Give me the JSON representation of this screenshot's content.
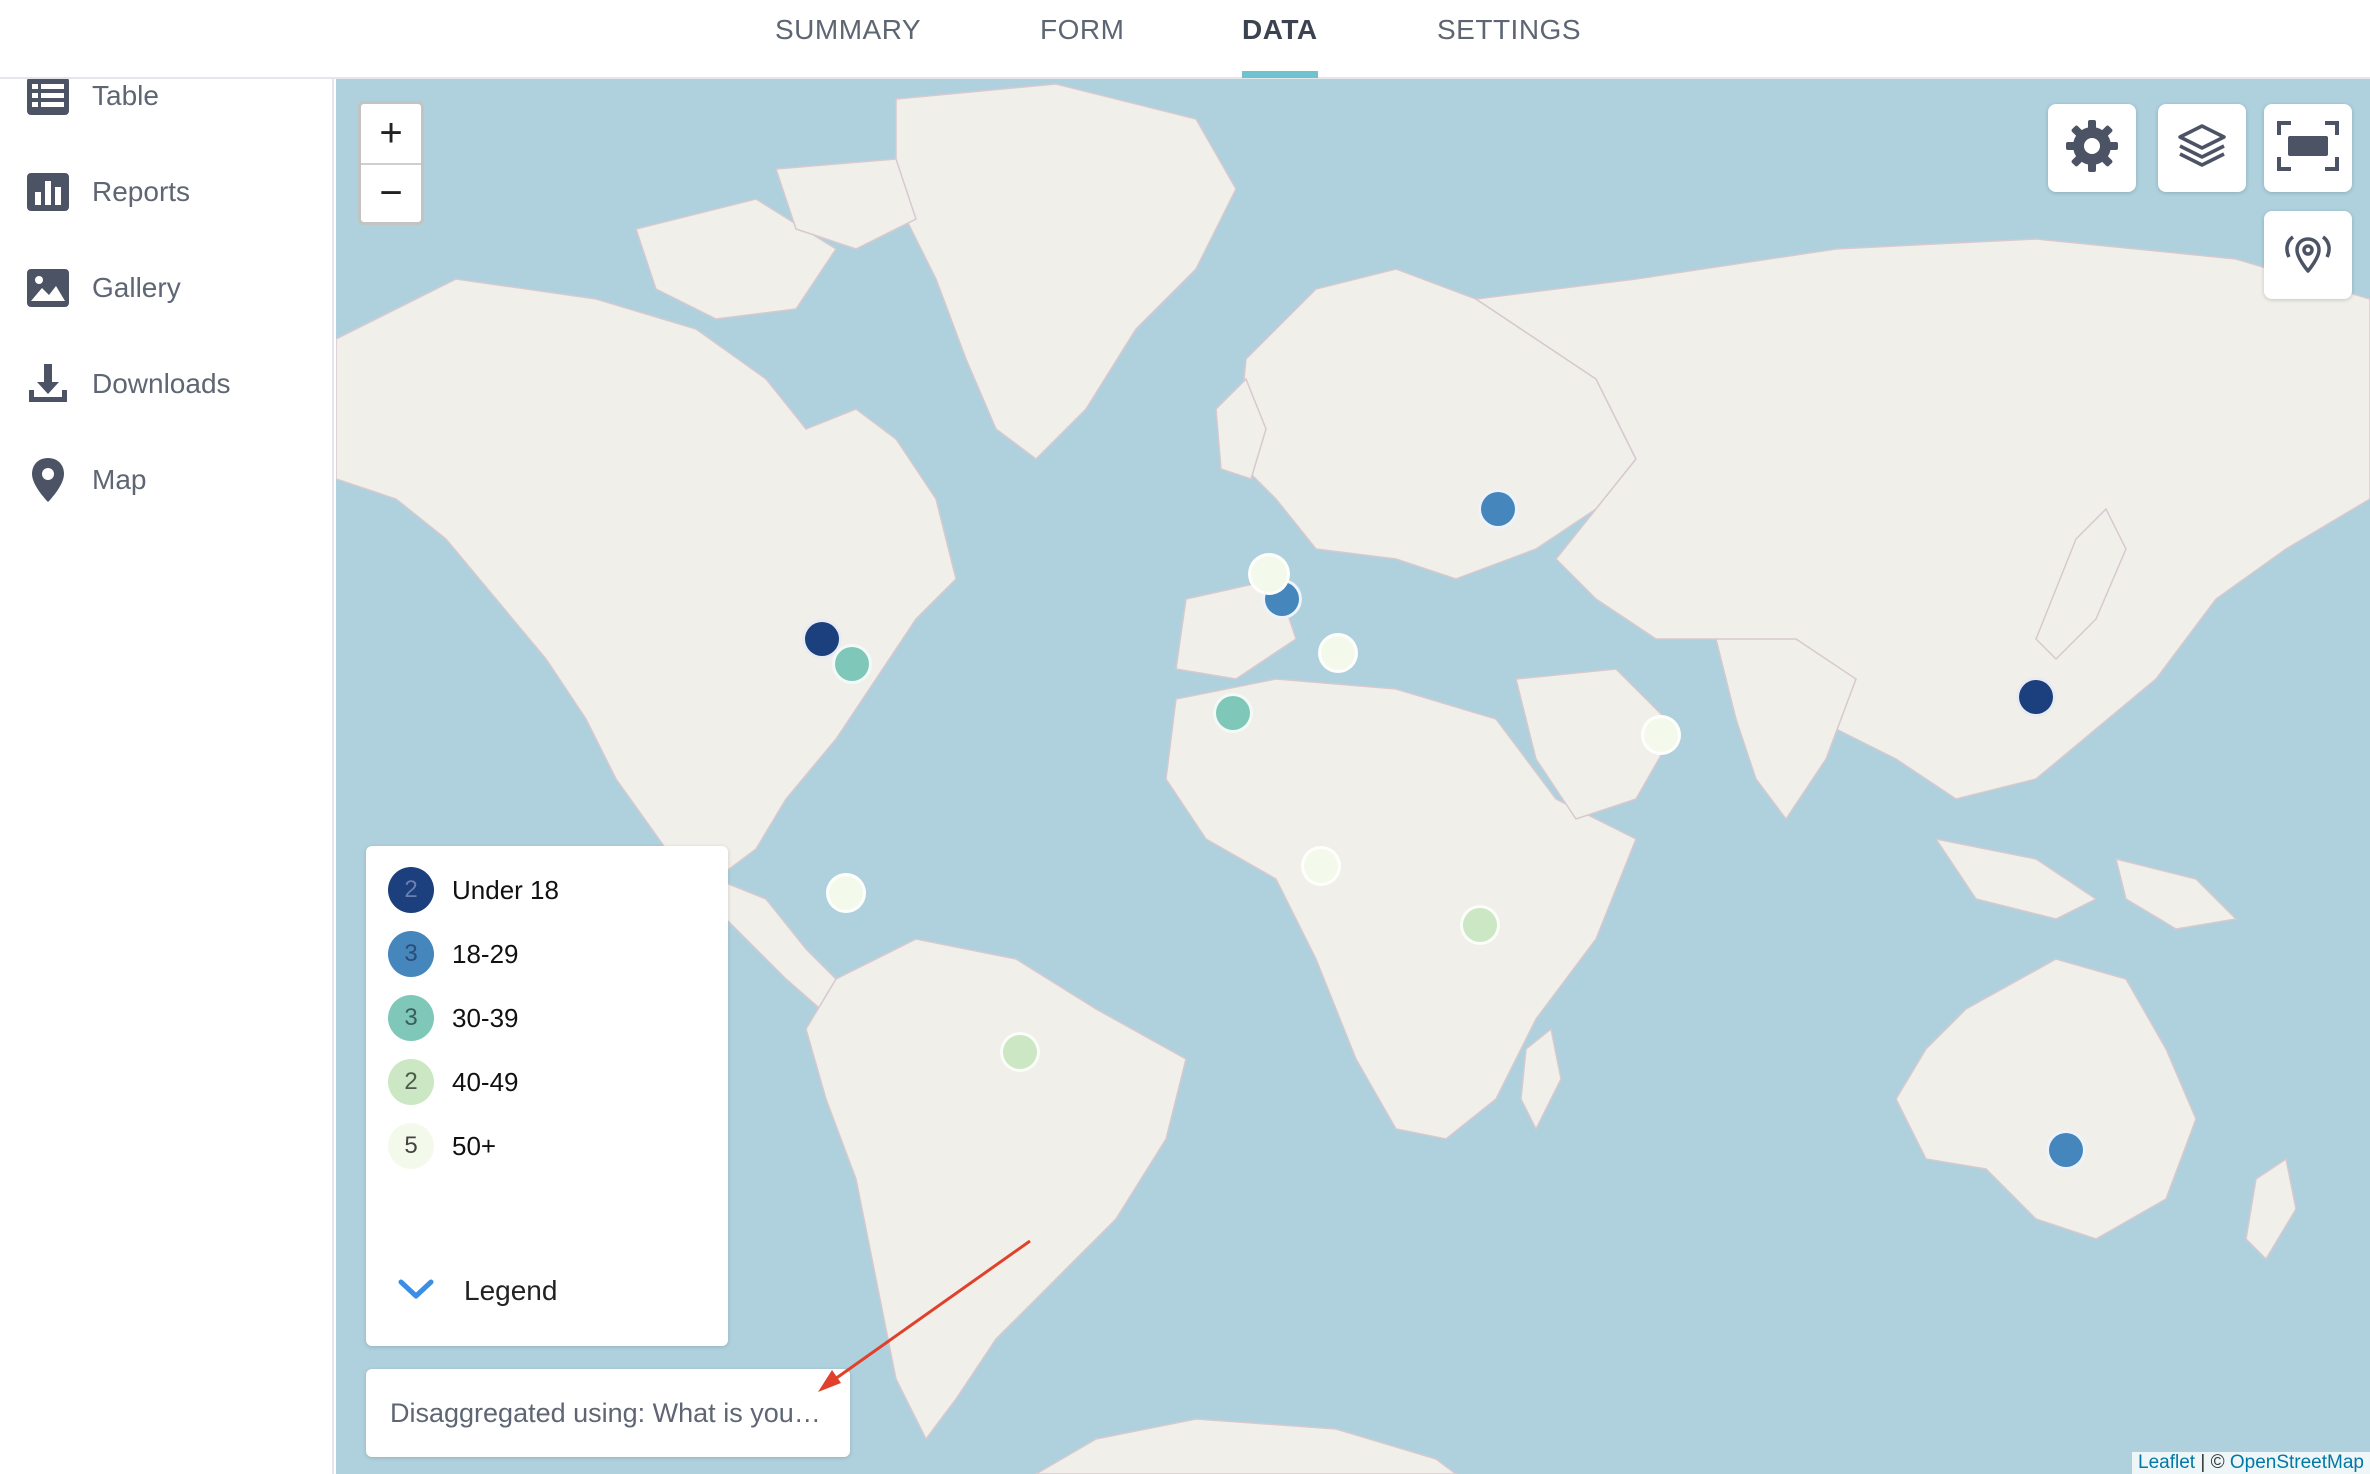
{
  "tabs": [
    {
      "label": "SUMMARY",
      "active": false
    },
    {
      "label": "FORM",
      "active": false
    },
    {
      "label": "DATA",
      "active": true
    },
    {
      "label": "SETTINGS",
      "active": false
    }
  ],
  "sidebar": {
    "items": [
      {
        "label": "Table",
        "icon": "table-icon"
      },
      {
        "label": "Reports",
        "icon": "bar-chart-icon"
      },
      {
        "label": "Gallery",
        "icon": "image-icon"
      },
      {
        "label": "Downloads",
        "icon": "download-icon"
      },
      {
        "label": "Map",
        "icon": "map-pin-icon"
      }
    ]
  },
  "map": {
    "zoom_in": "+",
    "zoom_out": "−",
    "buttons": [
      "gear-icon",
      "layers-icon",
      "fullscreen-icon",
      "marker-heatmap-icon"
    ],
    "legend": {
      "items": [
        {
          "count": "2",
          "label": "Under 18",
          "color": "#1c3f7d"
        },
        {
          "count": "3",
          "label": "18-29",
          "color": "#4586bd"
        },
        {
          "count": "3",
          "label": "30-39",
          "color": "#7fc7b9"
        },
        {
          "count": "2",
          "label": "40-49",
          "color": "#cbe7c4"
        },
        {
          "count": "5",
          "label": "50+",
          "color": "#f4faeb"
        }
      ],
      "toggle_label": "Legend"
    },
    "disaggregation_label": "Disaggregated using: What is you…",
    "attribution": {
      "leaflet": "Leaflet",
      "separator": " | © ",
      "osm": "OpenStreetMap"
    },
    "colors": {
      "water": "#aed1dd",
      "land": "#f1efea",
      "accent": "#6fc3d0",
      "arrow": "#e0412b"
    }
  }
}
